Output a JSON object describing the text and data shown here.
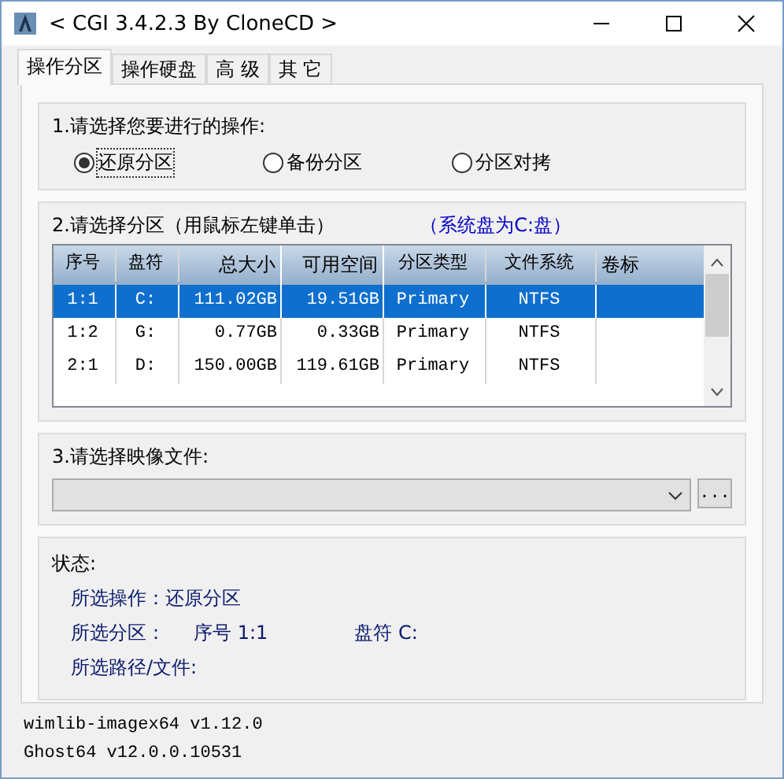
{
  "window": {
    "title": "< CGI 3.4.2.3 By CloneCD >"
  },
  "tabs": [
    {
      "label": "操作分区",
      "selected": true
    },
    {
      "label": "操作硬盘",
      "selected": false
    },
    {
      "label": "高 级",
      "selected": false
    },
    {
      "label": "其 它",
      "selected": false
    }
  ],
  "operation": {
    "label": "1.请选择您要进行的操作:",
    "options": [
      {
        "label": "还原分区",
        "selected": true
      },
      {
        "label": "备份分区",
        "selected": false
      },
      {
        "label": "分区对拷",
        "selected": false
      }
    ]
  },
  "partitions": {
    "label": "2.请选择分区（用鼠标左键单击）",
    "note": "（系统盘为C:盘）",
    "columns": [
      "序号",
      "盘符",
      "总大小",
      "可用空间",
      "分区类型",
      "文件系统",
      "卷标"
    ],
    "rows": [
      {
        "cells": [
          "1:1",
          "C:",
          "111.02GB",
          "19.51GB",
          "Primary",
          "NTFS"
        ],
        "selected": true
      },
      {
        "cells": [
          "1:2",
          "G:",
          "0.77GB",
          "0.33GB",
          "Primary",
          "NTFS"
        ],
        "selected": false
      },
      {
        "cells": [
          "2:1",
          "D:",
          "150.00GB",
          "119.61GB",
          "Primary",
          "NTFS"
        ],
        "selected": false
      }
    ]
  },
  "image_file": {
    "label": "3.请选择映像文件:",
    "browse": "..."
  },
  "status": {
    "label": "状态:",
    "lines": [
      [
        "所选操作：还原分区"
      ],
      [
        "所选分区：",
        "序号 1:1",
        "盘符 C:"
      ],
      [
        "所选路径/文件:"
      ]
    ]
  },
  "versions": [
    "wimlib-imagex64 v1.12.0",
    "Ghost64 v12.0.0.10531"
  ]
}
